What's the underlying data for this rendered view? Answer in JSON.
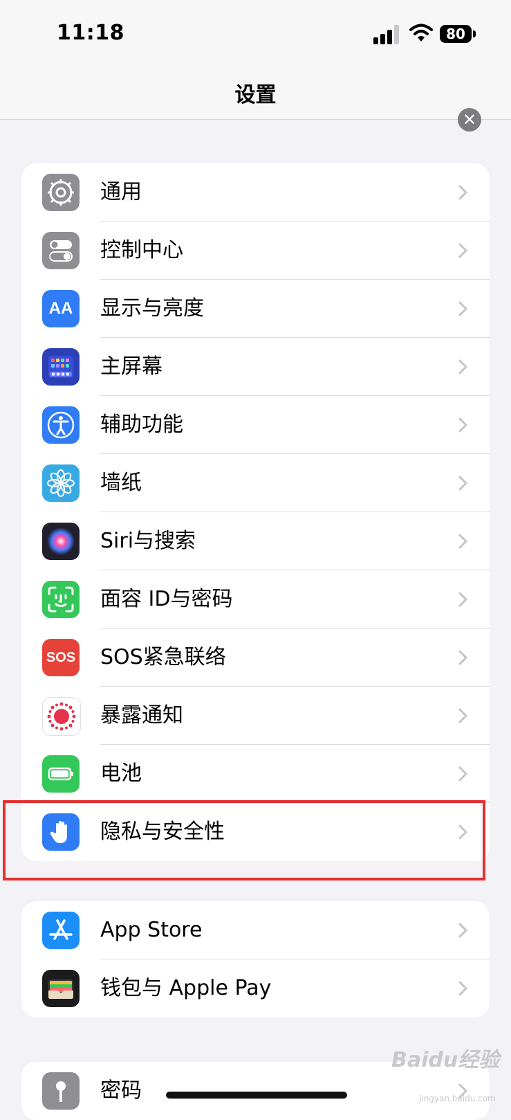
{
  "status": {
    "time": "11:18",
    "battery": "80"
  },
  "nav": {
    "title": "设置",
    "close_symbol": "✕"
  },
  "group1": [
    {
      "label": "通用",
      "icon": "gear-icon",
      "color": "#8e8e93"
    },
    {
      "label": "控制中心",
      "icon": "toggles-icon",
      "color": "#8e8e93"
    },
    {
      "label": "显示与亮度",
      "icon": "text-size-icon",
      "color": "#2f7cf6",
      "glyph": "AA"
    },
    {
      "label": "主屏幕",
      "icon": "home-screen-icon",
      "color": "#2b3fb6"
    },
    {
      "label": "辅助功能",
      "icon": "accessibility-icon",
      "color": "#2f7cf6"
    },
    {
      "label": "墙纸",
      "icon": "flower-icon",
      "color": "#38a9e3"
    },
    {
      "label": "Siri与搜索",
      "icon": "siri-icon",
      "color": "#1f1f2e"
    },
    {
      "label": "面容 ID与密码",
      "icon": "face-id-icon",
      "color": "#34c759"
    },
    {
      "label": "SOS紧急联络",
      "icon": "sos-icon",
      "color": "#e5433a",
      "glyph": "SOS"
    },
    {
      "label": "暴露通知",
      "icon": "exposure-icon",
      "color": "#ffffff"
    },
    {
      "label": "电池",
      "icon": "battery-icon",
      "color": "#34c759"
    },
    {
      "label": "隐私与安全性",
      "icon": "hand-icon",
      "color": "#2f7cf6"
    }
  ],
  "group2": [
    {
      "label": "App Store",
      "icon": "app-store-icon",
      "color": "#1c8ef9"
    },
    {
      "label": "钱包与 Apple Pay",
      "icon": "wallet-icon",
      "color": "#1c1c1e"
    }
  ],
  "group3": [
    {
      "label": "密码",
      "icon": "key-icon",
      "color": "#8e8e93"
    }
  ],
  "watermark": {
    "text": "Baidu经验",
    "sub": "jingyan.baidu.com"
  }
}
